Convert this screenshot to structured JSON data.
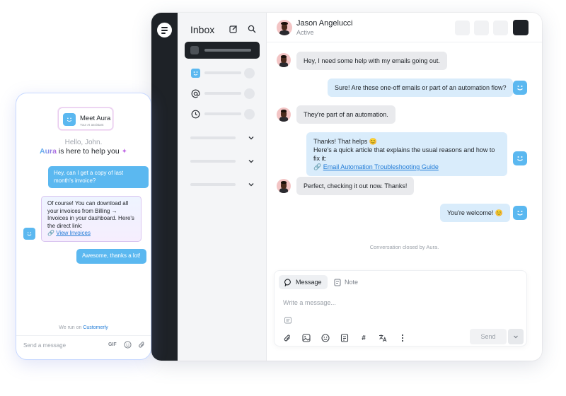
{
  "inbox": {
    "title": "Inbox"
  },
  "conversation": {
    "contact_name": "Jason Angelucci",
    "contact_status": "Active",
    "messages": [
      {
        "from": "customer",
        "text": "Hey, I need some help with my emails going out."
      },
      {
        "from": "agent",
        "text": "Sure! Are these one-off emails or part of an automation flow?"
      },
      {
        "from": "customer",
        "text": "They're part of an automation."
      },
      {
        "from": "agent",
        "line1": "Thanks! That helps 😊",
        "line2": "Here's a quick article that explains the usual reasons and how to fix it:",
        "link_prefix": "🔗",
        "link": "Email Automation Troubleshooting Guide"
      },
      {
        "from": "customer",
        "text": "Perfect, checking it out now. Thanks!"
      },
      {
        "from": "agent",
        "text": "You're welcome! 😊"
      }
    ],
    "closed_note": "Conversation closed by Aura."
  },
  "composer": {
    "tab_message": "Message",
    "tab_note": "Note",
    "placeholder": "Write a message...",
    "send_label": "Send"
  },
  "widget": {
    "meet_title": "Meet Aura",
    "meet_subtitle": "Your AI assistant",
    "hello": "Hello, John.",
    "tagline_name": "Aura",
    "tagline_rest": " is here to help you",
    "messages": [
      {
        "from": "user",
        "text": "Hey, can I get a copy of last month's invoice?"
      },
      {
        "from": "bot",
        "text": "Of course! You can download all your invoices from Billing → Invoices in your dashboard. Here's the direct link:",
        "link_prefix": "🔗",
        "link": "View Invoices"
      },
      {
        "from": "user",
        "text": "Awesome, thanks a lot!"
      }
    ],
    "powered_prefix": "We run on",
    "powered_brand": "Customerly",
    "input_placeholder": "Send a message",
    "gif_label": "GIF"
  },
  "colors": {
    "accent": "#5bb8f0",
    "dark": "#1e2227",
    "agent_bubble": "#d9ecfb",
    "customer_bubble": "#e9eaed",
    "link": "#1f7ad6"
  }
}
